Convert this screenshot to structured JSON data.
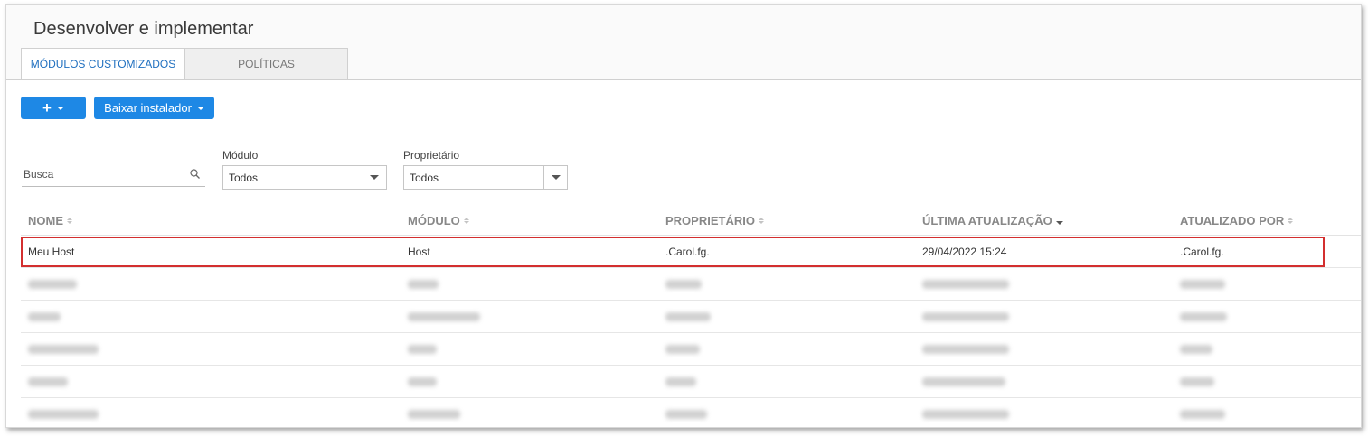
{
  "page": {
    "title": "Desenvolver e implementar"
  },
  "tabs": [
    {
      "label": "MÓDULOS CUSTOMIZADOS",
      "active": true
    },
    {
      "label": "POLÍTICAS",
      "active": false
    }
  ],
  "toolbar": {
    "add_label": "+",
    "download_label": "Baixar instalador"
  },
  "filters": {
    "search_placeholder": "Busca",
    "module": {
      "label": "Módulo",
      "value": "Todos"
    },
    "owner": {
      "label": "Proprietário",
      "value": "Todos"
    }
  },
  "table": {
    "columns": [
      "NOME",
      "MÓDULO",
      "PROPRIETÁRIO",
      "ÚLTIMA ATUALIZAÇÃO",
      "ATUALIZADO POR"
    ],
    "sorted_column": "ÚLTIMA ATUALIZAÇÃO",
    "sort_direction": "descending",
    "highlighted_row": {
      "name": "Meu Host",
      "module": "Host",
      "owner": ".Carol.fg.",
      "updated": "29/04/2022 15:24",
      "updated_by": ".Carol.fg."
    },
    "blurred_row_count": 5
  },
  "colors": {
    "accent": "#1e88e5",
    "active_tab_text": "#1f6fbf",
    "highlight_border": "#d32f2f"
  }
}
